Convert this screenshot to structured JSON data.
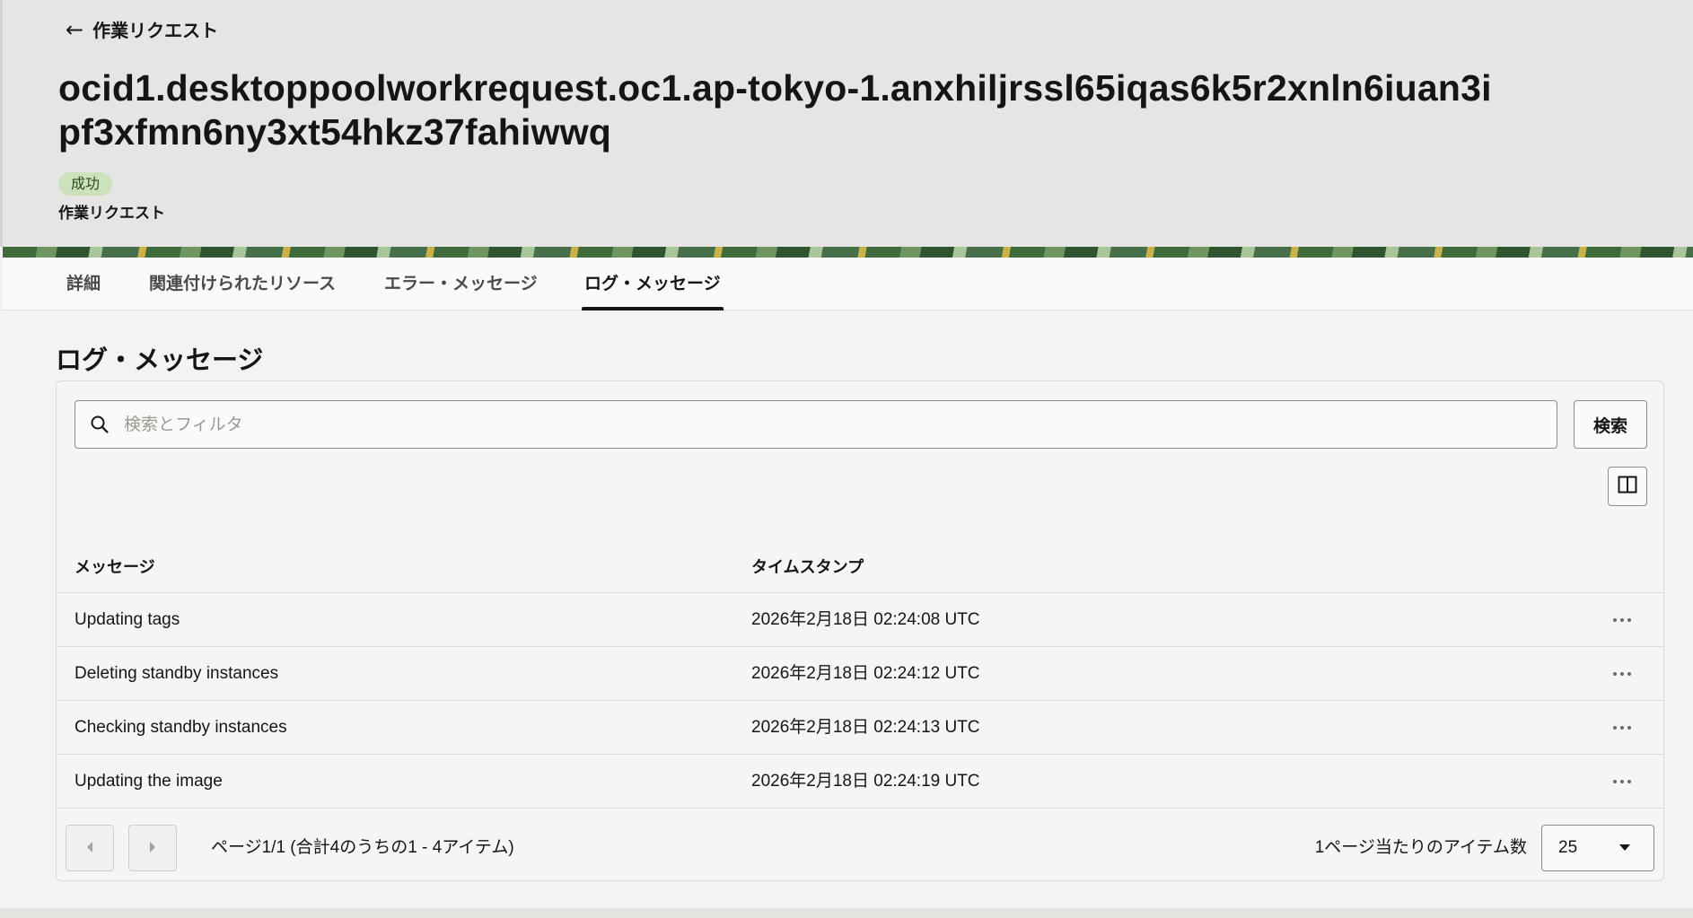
{
  "header": {
    "back_label": "作業リクエスト",
    "title": "ocid1.desktoppoolworkrequest.oc1.ap-tokyo-1.anxhiljrssl65iqas6k5r2xnln6iuan3ipf3xfmn6ny3xt54hkz37fahiwwq",
    "status_badge": "成功",
    "subtitle": "作業リクエスト"
  },
  "tabs": [
    {
      "label": "詳細"
    },
    {
      "label": "関連付けられたリソース"
    },
    {
      "label": "エラー・メッセージ"
    },
    {
      "label": "ログ・メッセージ",
      "active": true
    }
  ],
  "section": {
    "title": "ログ・メッセージ"
  },
  "search": {
    "placeholder": "検索とフィルタ",
    "button_label": "検索"
  },
  "table": {
    "columns": [
      "メッセージ",
      "タイムスタンプ"
    ],
    "rows": [
      {
        "message": "Updating tags",
        "timestamp": "2026年2月18日 02:24:08 UTC"
      },
      {
        "message": "Deleting standby instances",
        "timestamp": "2026年2月18日 02:24:12 UTC"
      },
      {
        "message": "Checking standby instances",
        "timestamp": "2026年2月18日 02:24:13 UTC"
      },
      {
        "message": "Updating the image",
        "timestamp": "2026年2月18日 02:24:19 UTC"
      }
    ]
  },
  "pagination": {
    "page_info": "ページ1/1 (合計4のうちの1 - 4アイテム)",
    "per_page_label": "1ページ当たりのアイテム数",
    "per_page_value": "25"
  },
  "icons": {
    "back": "arrow-left-icon",
    "search": "search-icon",
    "columns": "columns-icon",
    "prev": "chevron-left-icon",
    "next": "chevron-right-icon",
    "more": "more-horizontal-icon",
    "dropdown": "caret-down-icon"
  }
}
